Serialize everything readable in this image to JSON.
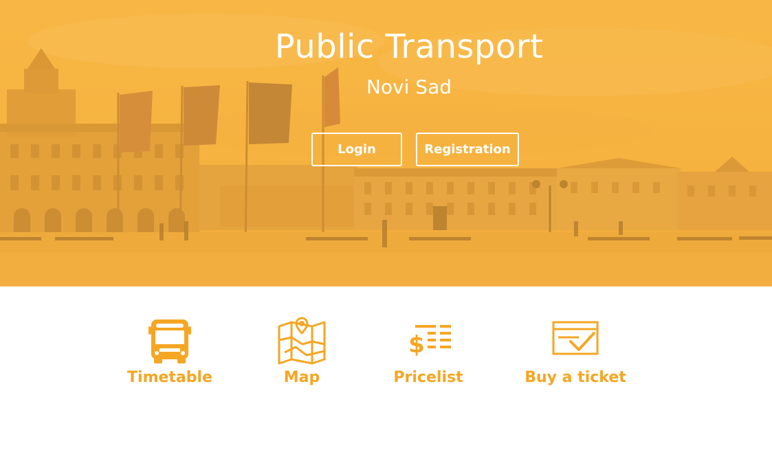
{
  "hero": {
    "title": "Public Transport",
    "subtitle": "Novi Sad",
    "buttons": {
      "login": "Login",
      "registration": "Registration"
    }
  },
  "features": [
    {
      "label": "Timetable",
      "icon": "bus-icon"
    },
    {
      "label": "Map",
      "icon": "map-icon"
    },
    {
      "label": "Pricelist",
      "icon": "pricelist-icon"
    },
    {
      "label": "Buy a ticket",
      "icon": "ticket-checkmark-icon"
    }
  ],
  "colors": {
    "accent": "#f5a623",
    "hero_overlay": "#f5b241",
    "text_on_hero": "#ffffff"
  }
}
